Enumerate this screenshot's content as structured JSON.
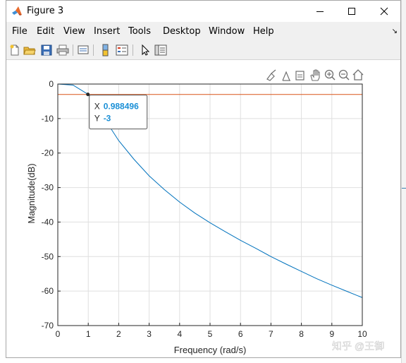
{
  "window": {
    "title": "Figure 3"
  },
  "menu": {
    "items": [
      "File",
      "Edit",
      "View",
      "Insert",
      "Tools",
      "Desktop",
      "Window",
      "Help"
    ]
  },
  "datatip": {
    "x_label": "X",
    "x_value": "0.988496",
    "y_label": "Y",
    "y_value": "-3"
  },
  "watermark": "知乎 @王御",
  "colors": {
    "curve": "#0072bd",
    "cutoff_line": "#d95319",
    "datatip_value": "#1a8fd6"
  },
  "chart_data": {
    "type": "line",
    "xlabel": "Frequency (rad/s)",
    "ylabel": "Magnitude(dB)",
    "xlim": [
      0,
      10
    ],
    "ylim": [
      -70,
      0
    ],
    "x_ticks": [
      0,
      1,
      2,
      3,
      4,
      5,
      6,
      7,
      8,
      9,
      10
    ],
    "y_ticks": [
      0,
      -10,
      -20,
      -30,
      -40,
      -50,
      -60,
      -70
    ],
    "grid": true,
    "series": [
      {
        "type": "line",
        "x": [
          0,
          0.5,
          1.0,
          1.5,
          2.0,
          2.5,
          3.0,
          3.5,
          4.0,
          4.5,
          5.0,
          5.5,
          6.0,
          6.5,
          7.0,
          7.5,
          8.0,
          8.5,
          9.0,
          9.5,
          10.0
        ],
        "y": [
          0,
          -0.3,
          -3.0,
          -9.6,
          -16.4,
          -21.8,
          -26.6,
          -30.6,
          -34.2,
          -37.4,
          -40.2,
          -42.8,
          -45.3,
          -47.6,
          -50.0,
          -52.2,
          -54.3,
          -56.4,
          -58.3,
          -60.1,
          -61.9
        ]
      },
      {
        "type": "line",
        "x": [
          0,
          10
        ],
        "y": [
          -3,
          -3
        ]
      }
    ],
    "annotations": [
      {
        "type": "datatip",
        "x": 0.988496,
        "y": -3
      }
    ]
  }
}
